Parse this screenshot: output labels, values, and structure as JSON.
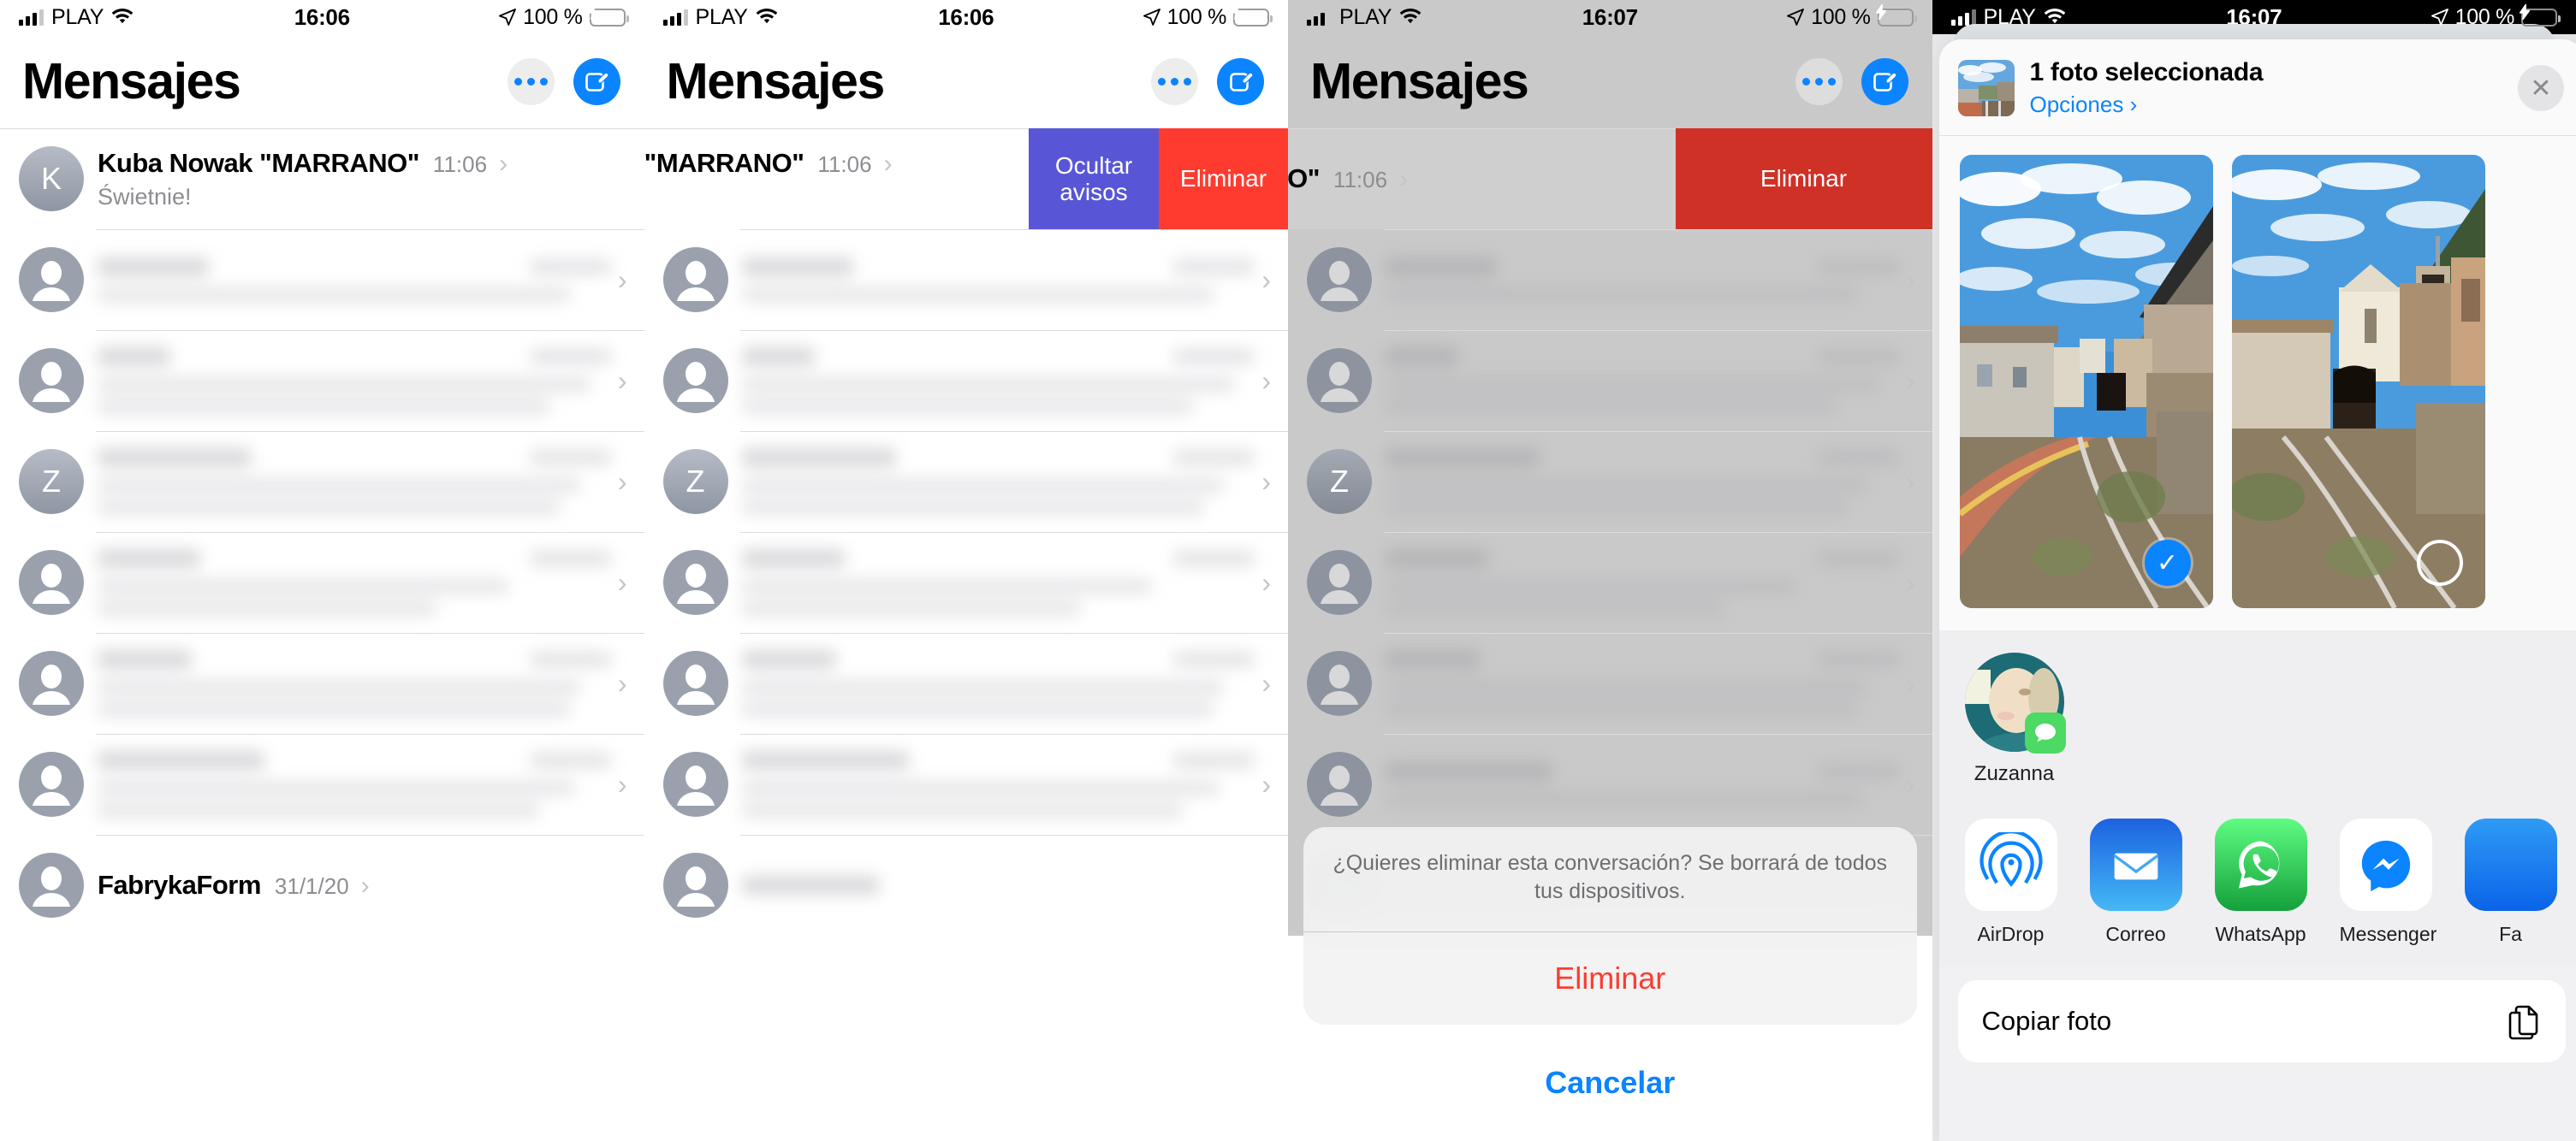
{
  "statusbars": [
    {
      "carrier": "PLAY",
      "time": "16:06",
      "battery_pct": "100 %"
    },
    {
      "carrier": "PLAY",
      "time": "16:06",
      "battery_pct": "100 %"
    },
    {
      "carrier": "PLAY",
      "time": "16:07",
      "battery_pct": "100 %"
    },
    {
      "carrier": "PLAY",
      "time": "16:07",
      "battery_pct": "100 %"
    }
  ],
  "messages_app": {
    "title": "Mensajes",
    "more_button": "more-button",
    "compose_button": "compose-button",
    "first_row": {
      "avatar_initial": "K",
      "name": "Kuba Nowak \"MARRANO\"",
      "time": "11:06",
      "preview": "Świetnie!"
    },
    "redacted_rows": [
      {
        "avatar_initial": "",
        "time": "",
        "name": ""
      },
      {
        "avatar_initial": "",
        "time": "",
        "name": ""
      },
      {
        "avatar_initial": "Z",
        "time": "",
        "name": ""
      },
      {
        "avatar_initial": "",
        "time": "",
        "name": ""
      },
      {
        "avatar_initial": "",
        "time": "",
        "name": ""
      },
      {
        "avatar_initial": "",
        "time": "",
        "name": ""
      }
    ],
    "last_row": {
      "name": "FabrykaForm",
      "time": "31/1/20"
    },
    "swipe_actions": {
      "mute_label": "Ocultar\navisos",
      "mute_label_line1": "Ocultar",
      "mute_label_line2": "avisos",
      "delete_label": "Eliminar",
      "mute_color": "#5856D6",
      "delete_color": "#FF3B30"
    },
    "alert": {
      "message": "¿Quieres eliminar esta conversación? Se borrará de todos tus dispositivos.",
      "destructive_label": "Eliminar",
      "cancel_label": "Cancelar",
      "destructive_color": "#FF3B30",
      "cancel_color": "#0B84FF"
    }
  },
  "share_sheet": {
    "title": "1 foto seleccionada",
    "options_label": "Opciones ›",
    "close_label": "✕",
    "photos": [
      {
        "name": "photo-1",
        "selected": true,
        "check_glyph": "✓"
      },
      {
        "name": "photo-2",
        "selected": false,
        "check_glyph": ""
      }
    ],
    "contacts": [
      {
        "name": "Zuzanna",
        "badge": "messages-app-badge"
      }
    ],
    "apps": [
      {
        "name": "AirDrop",
        "icon": "airdrop-icon"
      },
      {
        "name": "Correo",
        "icon": "mail-icon"
      },
      {
        "name": "WhatsApp",
        "icon": "whatsapp-icon"
      },
      {
        "name": "Messenger",
        "icon": "messenger-icon"
      },
      {
        "name": "Fa",
        "icon": "facebook-icon"
      }
    ],
    "actions": [
      {
        "label": "Copiar foto",
        "icon": "copy-icon"
      }
    ],
    "accent_color": "#0B84FF"
  }
}
